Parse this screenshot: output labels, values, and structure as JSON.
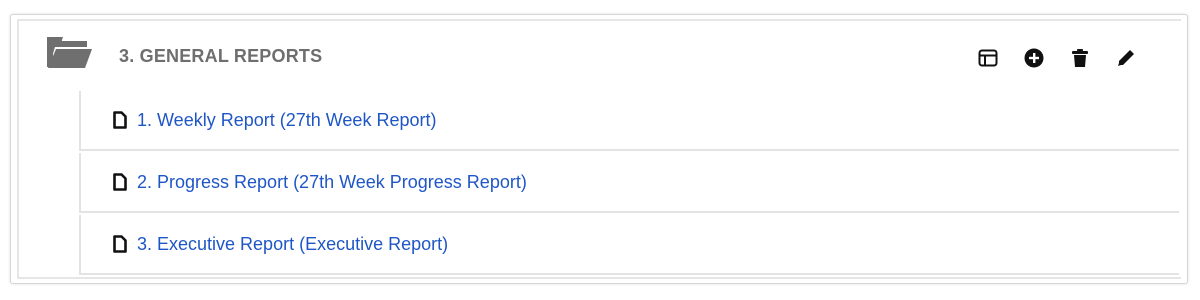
{
  "section": {
    "title": "3. GENERAL REPORTS",
    "icon": "folder-open-icon",
    "actions": [
      {
        "name": "layout-button",
        "icon": "layout-icon"
      },
      {
        "name": "add-button",
        "icon": "plus-circle-icon"
      },
      {
        "name": "delete-button",
        "icon": "trash-icon"
      },
      {
        "name": "edit-button",
        "icon": "pencil-icon"
      }
    ]
  },
  "reports": [
    {
      "label": "1. Weekly Report (27th Week Report)",
      "icon": "document-icon"
    },
    {
      "label": "2. Progress Report (27th Week Progress Report)",
      "icon": "document-icon"
    },
    {
      "label": "3. Executive Report (Executive Report)",
      "icon": "document-icon"
    }
  ],
  "colors": {
    "link": "#1f56c6",
    "title": "#6e6e6e",
    "folder": "#6f6f6f",
    "icon": "#111111"
  }
}
